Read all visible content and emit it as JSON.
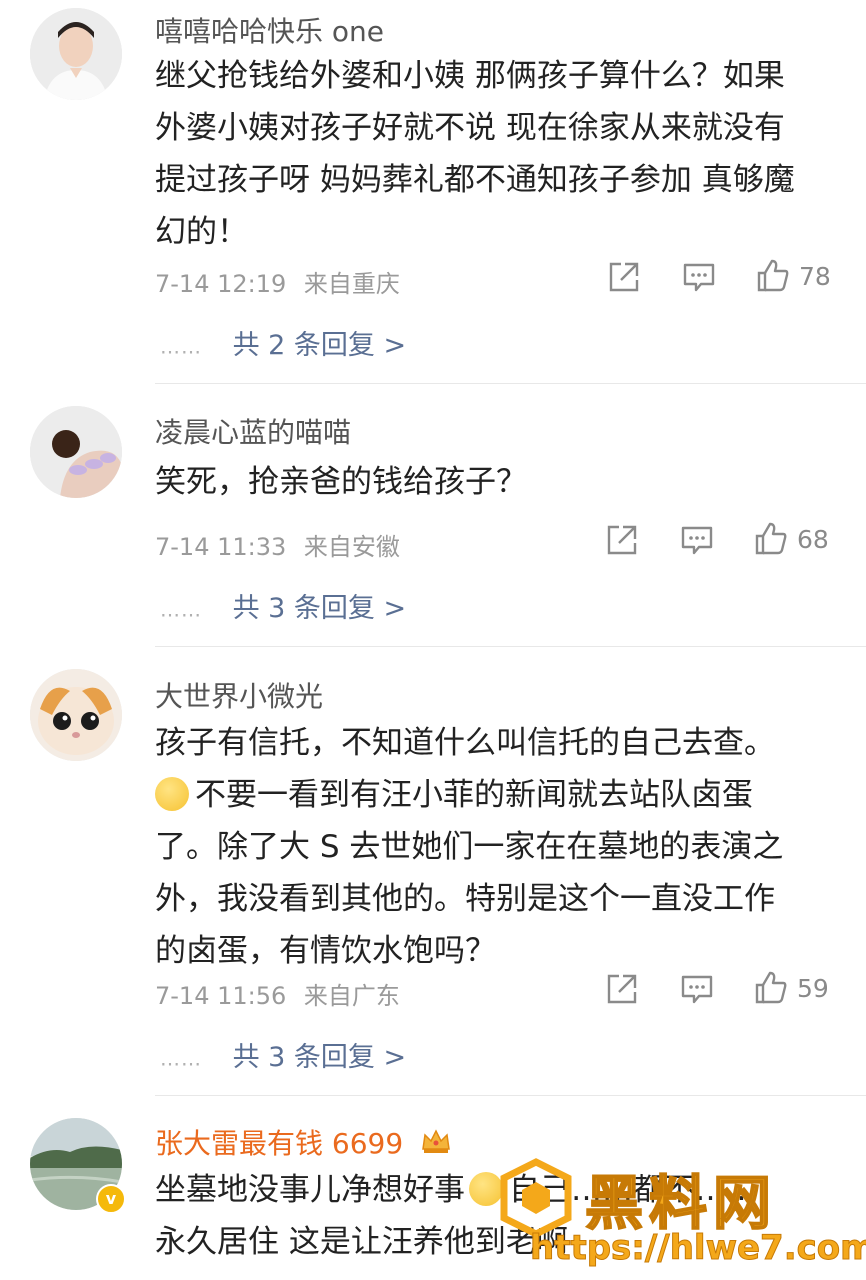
{
  "comments": [
    {
      "username": "嘻嘻哈哈快乐 one",
      "lines": [
        "继父抢钱给外婆和小姨 那俩孩子算什么？如果",
        "外婆小姨对孩子好就不说 现在徐家从来就没有",
        "提过孩子呀 妈妈葬礼都不通知孩子参加 真够魔",
        "幻的！"
      ],
      "time": "7-14 12:19",
      "location": "来自重庆",
      "likes": "78",
      "dots": "……",
      "replies": "共 2 条回复 >"
    },
    {
      "username": "凌晨心蓝的喵喵",
      "lines": [
        "笑死，抢亲爸的钱给孩子？"
      ],
      "time": "7-14 11:33",
      "location": "来自安徽",
      "likes": "68",
      "dots": "……",
      "replies": "共 3 条回复 >"
    },
    {
      "username": "大世界小微光",
      "lines": [
        "孩子有信托，不知道什么叫信托的自己去查。",
        "不要一看到有汪小菲的新闻就去站队卤蛋",
        "了。除了大 S 去世她们一家在在墓地的表演之",
        "外，我没看到其他的。特别是这个一直没工作",
        "的卤蛋，有情饮水饱吗？"
      ],
      "time": "7-14 11:56",
      "location": "来自广东",
      "likes": "59",
      "dots": "……",
      "replies": "共 3 条回复 >"
    },
    {
      "username": "张大雷最有钱 6699",
      "lines": [
        "坐墓地没事儿净想好事",
        "自己……都不……",
        "永久居住 这是让汪养他到老啊"
      ]
    }
  ],
  "icons": {
    "share": "share-icon",
    "comment": "comment-icon",
    "like": "thumbs-up-icon",
    "crown": "crown-icon",
    "verified": "verified-badge-icon"
  },
  "colors": {
    "reply_link": "#5a6f93",
    "vip_name": "#ea6a1e",
    "watermark": "#f4a81a"
  },
  "watermark": {
    "title": "黑料网",
    "url": "https://hlwe7.com"
  }
}
